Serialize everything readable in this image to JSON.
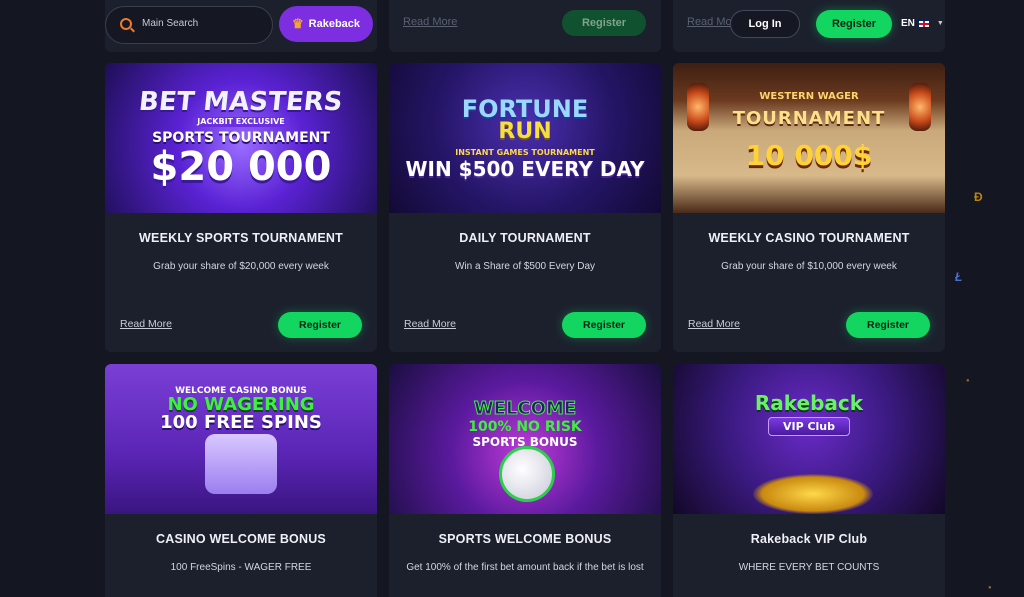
{
  "header": {
    "search_placeholder": "Main Search",
    "rakeback_label": "Rakeback",
    "login_label": "Log In",
    "register_label": "Register",
    "language": "EN"
  },
  "top_row": [
    {
      "read_more": "",
      "register": ""
    },
    {
      "read_more": "Read More",
      "register": "Register"
    },
    {
      "read_more": "Read More",
      "register": ""
    }
  ],
  "cards": [
    {
      "title": "WEEKLY SPORTS TOURNAMENT",
      "description": "Grab your share of $20,000 every week",
      "read_more": "Read More",
      "register": "Register",
      "banner": {
        "line1": "BET MASTERS",
        "line2": "JACKBIT EXCLUSIVE",
        "line3": "SPORTS TOURNAMENT",
        "line4": "$20 000"
      }
    },
    {
      "title": "DAILY TOURNAMENT",
      "description": "Win a Share of $500 Every Day",
      "read_more": "Read More",
      "register": "Register",
      "banner": {
        "line1": "FORTUNE",
        "line2": "RUN",
        "line3": "INSTANT GAMES TOURNAMENT",
        "line4": "WIN $500 EVERY DAY"
      }
    },
    {
      "title": "WEEKLY CASINO TOURNAMENT",
      "description": "Grab your share of $10,000 every week",
      "read_more": "Read More",
      "register": "Register",
      "banner": {
        "line1": "WESTERN WAGER",
        "line2": "TOURNAMENT",
        "line3": "10 000$"
      }
    },
    {
      "title": "CASINO WELCOME BONUS",
      "description": "100 FreeSpins - WAGER FREE",
      "banner": {
        "line1": "WELCOME CASINO BONUS",
        "line2": "NO WAGERING",
        "line3": "100 FREE SPINS"
      }
    },
    {
      "title": "SPORTS WELCOME BONUS",
      "description": "Get 100% of the first bet amount back if the bet is lost",
      "banner": {
        "line1": "WELCOME",
        "line2": "100% NO RISK",
        "line3": "SPORTS BONUS"
      }
    },
    {
      "title": "Rakeback VIP Club",
      "description": "WHERE EVERY BET COUNTS",
      "banner": {
        "line1": "Rakeback",
        "line2": "VIP Club"
      }
    }
  ],
  "colors": {
    "background": "#141722",
    "card": "#1c202d",
    "accent_green": "#12d660",
    "accent_purple": "#7c2ee0",
    "search_icon": "#f07a2c"
  }
}
